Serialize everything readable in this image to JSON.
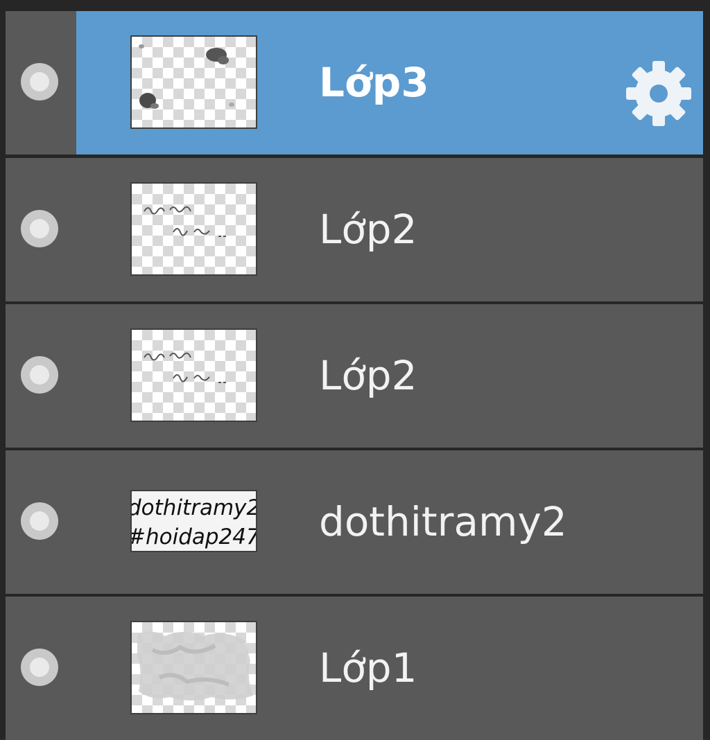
{
  "layers": [
    {
      "name": "Lớp3",
      "selected": true,
      "thumbnail": "blob-marks",
      "settings_icon": "gear-icon"
    },
    {
      "name": "Lớp2",
      "selected": false,
      "thumbnail": "handwriting"
    },
    {
      "name": "Lớp2",
      "selected": false,
      "thumbnail": "handwriting"
    },
    {
      "name": "dothitramy2",
      "selected": false,
      "thumbnail": "text-image",
      "thumb_text_line1": "dothitramy2",
      "thumb_text_line2": "#hoidap247"
    },
    {
      "name": "Lớp1",
      "selected": false,
      "thumbnail": "gray-fill"
    }
  ],
  "colors": {
    "selected_row": "#5b9bd0",
    "row": "#595959",
    "panel_bg": "#262626"
  }
}
